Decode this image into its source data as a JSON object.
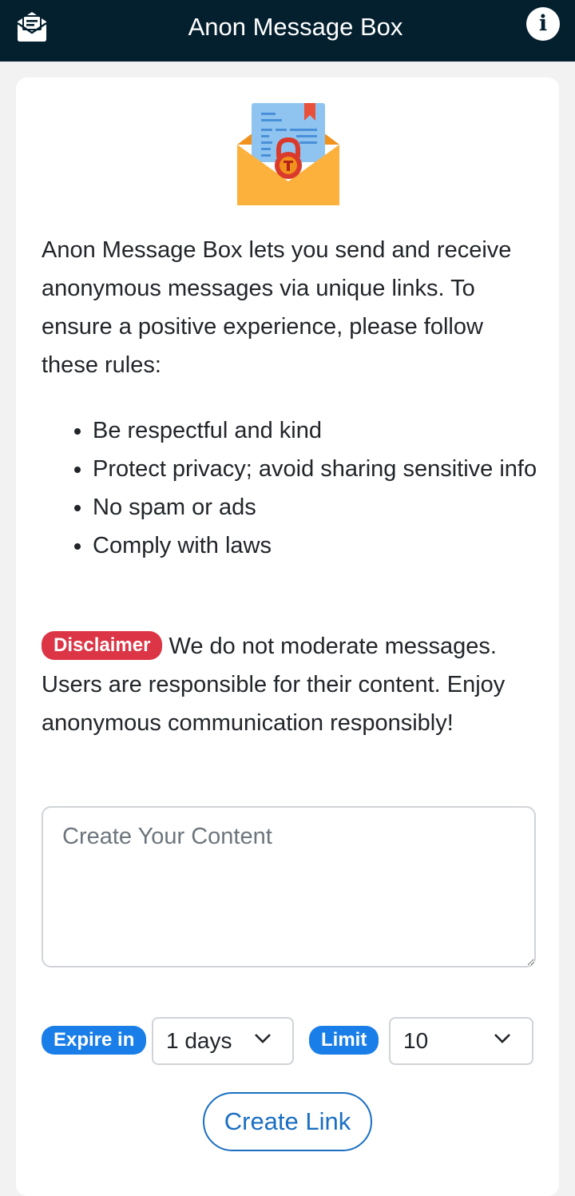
{
  "header": {
    "title": "Anon Message Box",
    "logo_icon": "envelope-message-icon",
    "info_icon": "info-icon",
    "info_glyph": "i"
  },
  "intro": "Anon Message Box lets you send and receive anonymous messages via unique links. To ensure a positive experience, please follow these rules:",
  "rules": [
    "Be respectful and kind",
    "Protect privacy; avoid sharing sensitive info",
    "No spam or ads",
    "Comply with laws"
  ],
  "disclaimer": {
    "badge": "Disclaimer",
    "text": "We do not moderate messages. Users are responsible for their content. Enjoy anonymous communication responsibly!"
  },
  "content_input": {
    "placeholder": "Create Your Content",
    "value": ""
  },
  "options": {
    "expire_label": "Expire in",
    "expire_value": "1 days",
    "limit_label": "Limit",
    "limit_value": "10"
  },
  "create_button": "Create Link",
  "colors": {
    "header_bg": "#04202f",
    "danger": "#dc3545",
    "primary": "#1a7ee8",
    "button_outline": "#1a6fc2"
  }
}
